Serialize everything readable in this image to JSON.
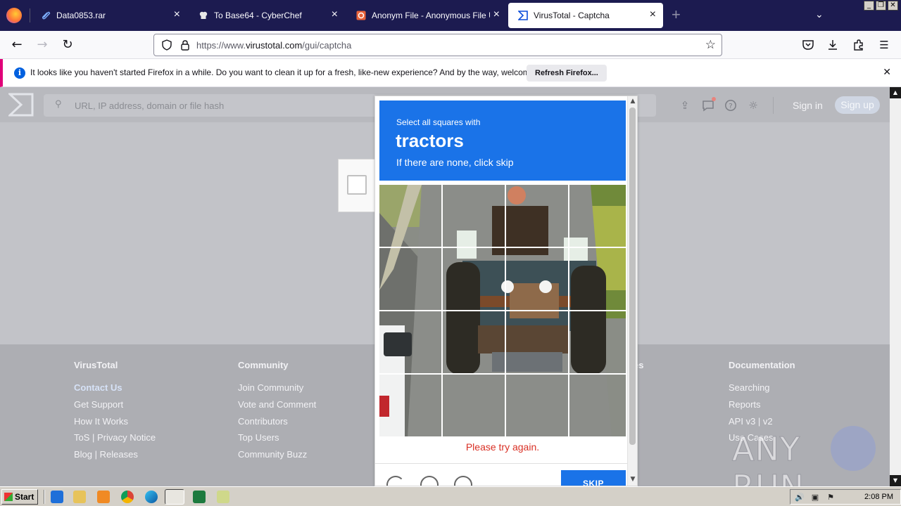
{
  "browser": {
    "tabs": [
      {
        "label": "Data0853.rar",
        "icon": "paperclip-icon",
        "active": false
      },
      {
        "label": "To Base64 - CyberChef",
        "icon": "chef-hat-icon",
        "active": false
      },
      {
        "label": "Anonym File - Anonymous File Uplo",
        "icon": "anonym-file-icon",
        "active": false
      },
      {
        "label": "VirusTotal - Captcha",
        "icon": "virustotal-icon",
        "active": true
      }
    ],
    "new_tab_label": "+",
    "url": {
      "prefix": "https://www.",
      "host": "virustotal.com",
      "path": "/gui/captcha"
    }
  },
  "notification": {
    "message": "It looks like you haven't started Firefox in a while. Do you want to clean it up for a fresh, like-new experience? And by the way, welcome back!",
    "button": "Refresh Firefox..."
  },
  "vt": {
    "search_placeholder": "URL, IP address, domain or file hash",
    "sign_in": "Sign in",
    "sign_up": "Sign up",
    "footer": {
      "columns": [
        {
          "heading": "VirusTotal",
          "links": [
            "Contact Us",
            "Get Support",
            "How It Works",
            "ToS | Privacy Notice",
            "Blog | Releases"
          ]
        },
        {
          "heading": "Community",
          "links": [
            "Join Community",
            "Vote and Comment",
            "Contributors",
            "Top Users",
            "Community Buzz"
          ]
        },
        {
          "heading": "es",
          "links": []
        },
        {
          "heading": "Documentation",
          "links": [
            "Searching",
            "Reports",
            "API v3 | v2",
            "Use Cases"
          ]
        }
      ]
    }
  },
  "captcha": {
    "prompt": "Select all squares with",
    "object": "tractors",
    "hint": "If there are none, click skip",
    "error": "Please try again.",
    "skip_label": "SKIP"
  },
  "watermark": "ANY RUN",
  "taskbar": {
    "start_label": "Start",
    "clock": "2:08 PM"
  },
  "colors": {
    "captcha_blue": "#1a73e8",
    "error_red": "#d93025",
    "tab_strip": "#1c1b50",
    "notification_accent": "#e00078"
  }
}
